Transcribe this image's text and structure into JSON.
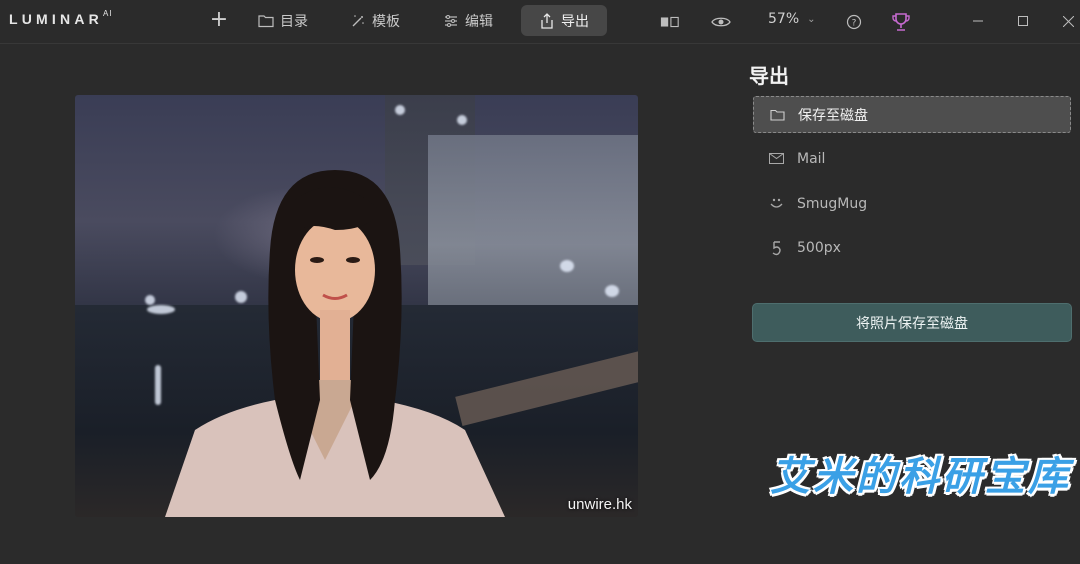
{
  "app": {
    "logo": "LUMINAR",
    "logo_sup": "AI"
  },
  "toolbar": {
    "tabs": [
      {
        "label": "目录",
        "icon": "folder-icon"
      },
      {
        "label": "模板",
        "icon": "magic-wand-icon"
      },
      {
        "label": "编辑",
        "icon": "sliders-icon"
      },
      {
        "label": "导出",
        "icon": "share-icon",
        "active": true
      }
    ],
    "zoom": "57%"
  },
  "panel": {
    "title": "导出",
    "items": [
      {
        "label": "保存至磁盘",
        "icon": "folder-icon",
        "selected": true
      },
      {
        "label": "Mail",
        "icon": "mail-icon"
      },
      {
        "label": "SmugMug",
        "icon": "smugmug-icon"
      },
      {
        "label": "500px",
        "icon": "500px-icon"
      }
    ],
    "save_button": "将照片保存至磁盘"
  },
  "photo": {
    "watermark": "unwire.hk"
  },
  "overlay_watermark": "艾米的科研宝库",
  "colors": {
    "background": "#2b2b2b",
    "accent_button": "#3e5c5c",
    "trophy": "#c66ad0",
    "overlay_text": "#3aa0e6"
  }
}
